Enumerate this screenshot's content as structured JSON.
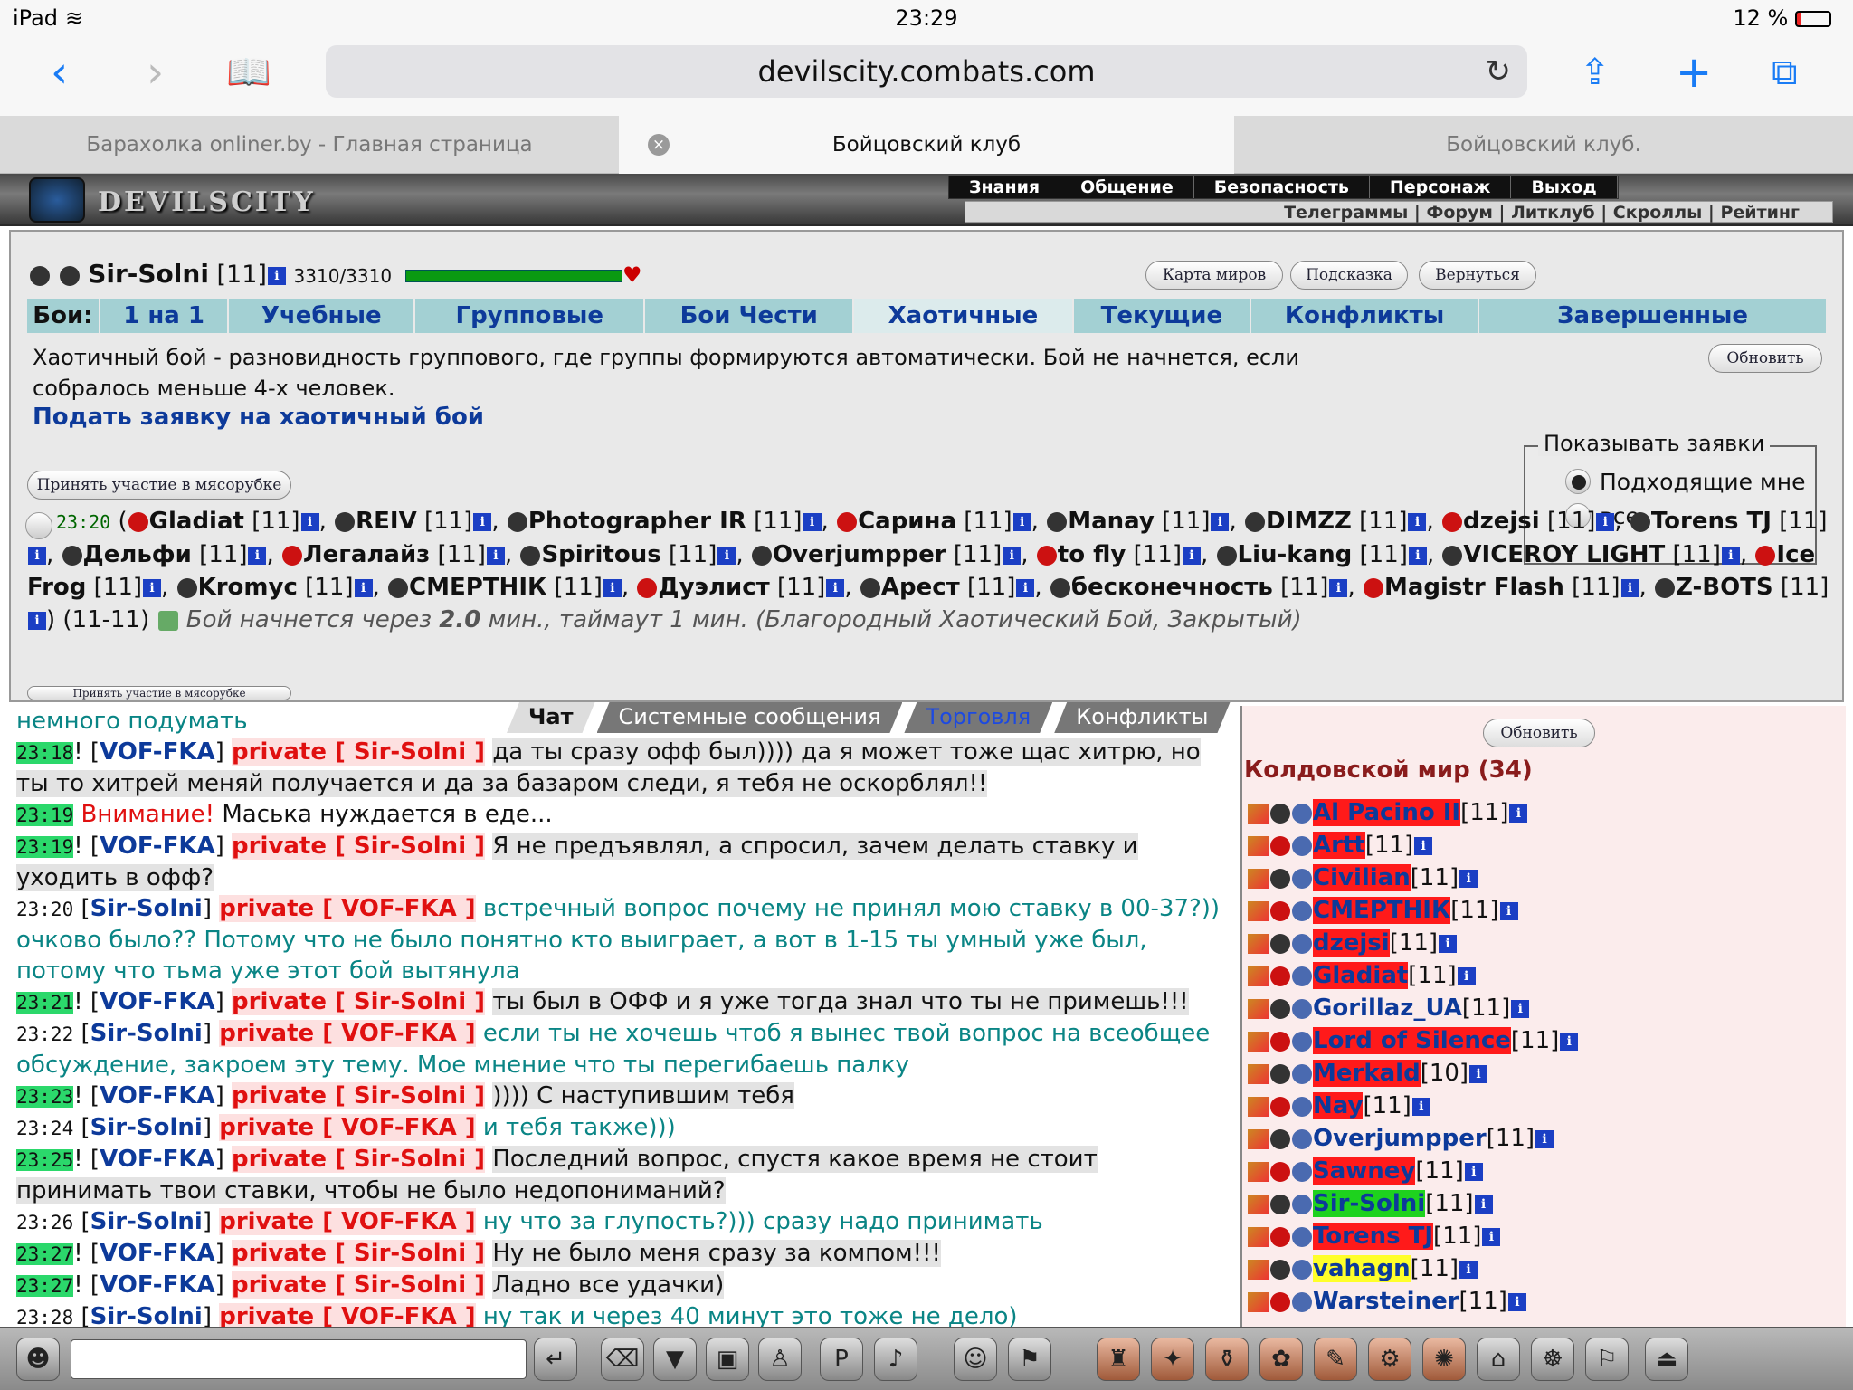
{
  "status": {
    "device": "iPad",
    "time": "23:29",
    "battery": "12 %"
  },
  "browser": {
    "url": "devilscity.combats.com",
    "tabs": [
      "Барахолка onliner.by - Главная страница",
      "Бойцовский клуб",
      "Бойцовский клуб."
    ]
  },
  "game": {
    "logo": "DEVILSCITY",
    "menu": [
      "Знания",
      "Общение",
      "Безопасность",
      "Персонаж",
      "Выход"
    ],
    "submenu": "Телеграммы | Форум | Литклуб | Скроллы | Рейтинг"
  },
  "player": {
    "name": "Sir-Solni",
    "level": "[11]",
    "hp": "3310/3310",
    "hp_fraction": 1.0
  },
  "buttons": {
    "worldmap": "Карта миров",
    "hint": "Подсказка",
    "back": "Вернуться",
    "refresh": "Обновить",
    "join": "Принять участие в мясорубке"
  },
  "battles": {
    "label": "Бои:",
    "tabs": [
      "1 на 1",
      "Учебные",
      "Групповые",
      "Бои Чести",
      "Хаотичные",
      "Текущие",
      "Конфликты",
      "Завершенные"
    ],
    "active": "Хаотичные"
  },
  "desc": "Хаотичный бой - разновидность группового, где группы формируются автоматически. Бой не начнется, если собралось меньше 4-х человек.",
  "apply": "Подать заявку на хаотичный бой",
  "show": {
    "legend": "Показывать заявки",
    "opt1": "Подходящие мне",
    "opt2": "все"
  },
  "fight": {
    "time": "23:20",
    "players": [
      "Gladiat",
      "REIV",
      "Photographer IR",
      "Сарина",
      "Manay",
      "DIMZZ",
      "dzejsi",
      "Torens TJ",
      "Дельфи",
      "Легалайз",
      "Spiritous",
      "Overjumpper",
      "to fly",
      "Liu-kang",
      "VICEROY LIGHT",
      "Ice Frog",
      "Kromyc",
      "СМЕРТНIК",
      "Дуэлист",
      "Арест",
      "бесконечность",
      "Magistr Flash",
      "Z-BOTS"
    ],
    "lvl": "[11]",
    "range": "(11-11)",
    "tail_pre": "Бой начнется через",
    "tail_num": "2.0",
    "tail_post": "мин., таймаут 1 мин. (Благородный Хаотический Бой, Закрытый)"
  },
  "chattabs": [
    "Чат",
    "Системные сообщения",
    "Торговля",
    "Конфликты"
  ],
  "chat": {
    "first": "немного подумать",
    "l1": {
      "t": "23:18",
      "from": "VOF-FKA",
      "to": "private [ Sir-Solni ]",
      "msg": "да ты сразу офф был)))) да я может тоже щас хитрю, но ты то хитрей меняй получается и да за базаром следи, я тебя не оскорблял!!"
    },
    "l2": {
      "t": "23:19",
      "warn": "Внимание!",
      "msg": "Маська нуждается в еде..."
    },
    "l3": {
      "t": "23:19",
      "from": "VOF-FKA",
      "to": "private [ Sir-Solni ]",
      "msg": "Я не предъявлял, а спросил, зачем делать ставку и уходить в офф?"
    },
    "l4": {
      "t": "23:20",
      "from": "Sir-Solni",
      "to": "private [ VOF-FKA ]",
      "msg": "встречный вопрос почему не принял мою ставку в 00-37?)) очково было?? Потому что не было понятно кто выиграет, а вот в 1-15 ты умный уже был, потому что тьма уже этот бой вытянула"
    },
    "l5": {
      "t": "23:21",
      "from": "VOF-FKA",
      "to": "private [ Sir-Solni ]",
      "msg": "ты был в ОФФ и я уже тогда знал что ты не примешь!!!"
    },
    "l6": {
      "t": "23:22",
      "from": "Sir-Solni",
      "to": "private [ VOF-FKA ]",
      "msg": "если ты не хочешь чтоб я вынес твой вопрос на всеобщее обсуждение, закроем эту тему. Мое мнение что ты перегибаешь палку"
    },
    "l7": {
      "t": "23:23",
      "from": "VOF-FKA",
      "to": "private [ Sir-Solni ]",
      "msg": ")))) С наступившим тебя"
    },
    "l8": {
      "t": "23:24",
      "from": "Sir-Solni",
      "to": "private [ VOF-FKA ]",
      "msg": "и тебя также)))"
    },
    "l9": {
      "t": "23:25",
      "from": "VOF-FKA",
      "to": "private [ Sir-Solni ]",
      "msg": "Последний вопрос, спустя какое время не стоит принимать твои ставки, чтобы не было недопониманий?"
    },
    "l10": {
      "t": "23:26",
      "from": "Sir-Solni",
      "to": "private [ VOF-FKA ]",
      "msg": "ну что за глупость?))) сразу надо принимать"
    },
    "l11": {
      "t": "23:27",
      "from": "VOF-FKA",
      "to": "private [ Sir-Solni ]",
      "msg": "Ну не было меня сразу за компом!!!"
    },
    "l12": {
      "t": "23:27",
      "from": "VOF-FKA",
      "to": "private [ Sir-Solni ]",
      "msg": "Ладно все удачки)"
    },
    "l13": {
      "t": "23:28",
      "from": "Sir-Solni",
      "to": "private [ VOF-FKA ]",
      "msg": "ну так и через 40 минут это тоже не дело)"
    }
  },
  "online": {
    "title": "Колдовской мир (34)",
    "users": [
      {
        "n": "Al Pacino II",
        "l": "[11]",
        "c": "red"
      },
      {
        "n": "Artt",
        "l": "[11]",
        "c": "red"
      },
      {
        "n": "Civilian",
        "l": "[11]",
        "c": "red"
      },
      {
        "n": "СМЕРТНIК",
        "l": "[11]",
        "c": "red"
      },
      {
        "n": "dzejsi",
        "l": "[11]",
        "c": "red"
      },
      {
        "n": "Gladiat",
        "l": "[11]",
        "c": "red"
      },
      {
        "n": "Gorillaz_UA",
        "l": "[11]",
        "c": ""
      },
      {
        "n": "Lord of Silence",
        "l": "[11]",
        "c": "red"
      },
      {
        "n": "Merkald",
        "l": "[10]",
        "c": "red"
      },
      {
        "n": "Nay",
        "l": "[11]",
        "c": "red"
      },
      {
        "n": "Overjumpper",
        "l": "[11]",
        "c": ""
      },
      {
        "n": "Sawney",
        "l": "[11]",
        "c": "red"
      },
      {
        "n": "Sir-Solni",
        "l": "[11]",
        "c": "grn"
      },
      {
        "n": "Torens TJ",
        "l": "[11]",
        "c": "red"
      },
      {
        "n": "vahagn",
        "l": "[11]",
        "c": "yel"
      },
      {
        "n": "Warsteiner",
        "l": "[11]",
        "c": ""
      }
    ]
  }
}
